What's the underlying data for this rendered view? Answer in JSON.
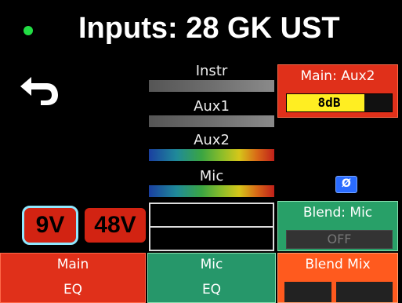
{
  "header": {
    "title": "Inputs: 28 GK UST",
    "status_color": "#22dd44"
  },
  "meters": [
    {
      "label": "Instr",
      "style": "gray"
    },
    {
      "label": "Aux1",
      "style": "gray"
    },
    {
      "label": "Aux2",
      "style": "color"
    },
    {
      "label": "Mic",
      "style": "color"
    }
  ],
  "aux_panel": {
    "title": "Main: Aux2",
    "value": "8dB",
    "level_percent": 74
  },
  "phase_icon": {
    "name": "phase-invert-icon",
    "glyph": "Ø"
  },
  "power": {
    "nine_v": "9V",
    "forty_eight_v": "48V"
  },
  "blend": {
    "title": "Blend: Mic",
    "state": "OFF"
  },
  "bottom": {
    "main_eq": {
      "line1": "Main",
      "line2": "EQ"
    },
    "mic_eq": {
      "line1": "Mic",
      "line2": "EQ"
    },
    "blend_mix": {
      "label": "Blend Mix"
    }
  },
  "colors": {
    "red": "#e0301a",
    "green": "#28a068",
    "orange": "#ff5a1e",
    "yellow": "#ffee22",
    "phase_blue": "#2a6cff"
  }
}
